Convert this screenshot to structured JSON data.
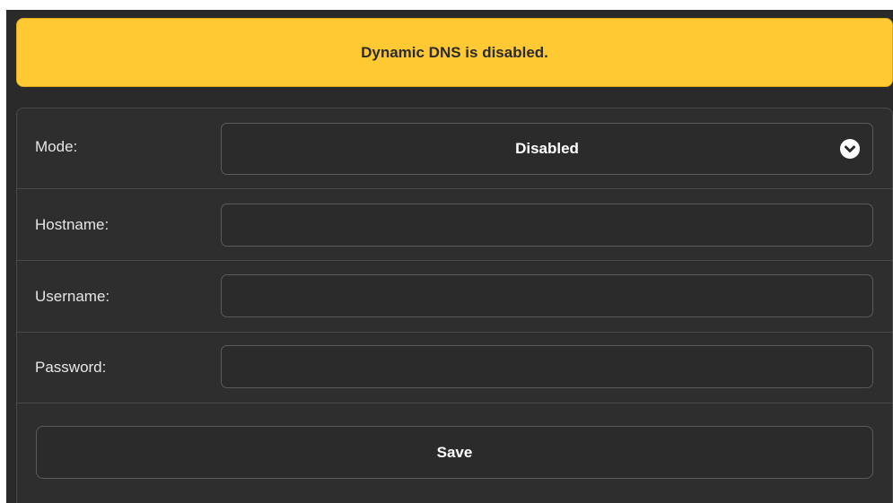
{
  "banner": {
    "message": "Dynamic DNS is disabled."
  },
  "form": {
    "mode": {
      "label": "Mode:",
      "selected": "Disabled"
    },
    "hostname": {
      "label": "Hostname:",
      "value": "",
      "placeholder": ""
    },
    "username": {
      "label": "Username:",
      "value": "",
      "placeholder": ""
    },
    "password": {
      "label": "Password:",
      "value": "",
      "placeholder": ""
    },
    "save_label": "Save"
  },
  "colors": {
    "banner_bg": "#fec933",
    "panel_bg": "#2e2e2e",
    "text_light": "#e6e6e6"
  },
  "icons": {
    "mode_dropdown": "chevron-down-icon"
  }
}
